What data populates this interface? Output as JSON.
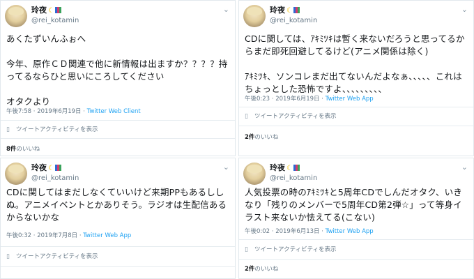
{
  "tweets": [
    {
      "display_name": "玲夜",
      "handle": "@rei_kotamin",
      "text": "あくたずいんふぉへ\n\n今年、原作ＣＤ関連で他に新情報は出ますか？？？？持ってるならひと思いにころしてください\n\nオタクより",
      "time": "午後7:58 · 2019年6月19日 · ",
      "source": "Twitter Web Client",
      "activity": "ツイートアクティビティを表示",
      "likes_count": "8件",
      "likes_label": "のいいね"
    },
    {
      "display_name": "玲夜",
      "handle": "@rei_kotamin",
      "text": "CDに関しては、ｱｷﾐﾂｷは暫く来ないだろうと思ってるからまだ即死回避してるけど(アニメ関係は除く)\n\nｱｷﾐﾂｷ、ソンコレまだ出てないんだよなぁ、、、、、これはちょっとした恐怖ですよ、、、、、、、、、",
      "time": "午後0:23 · 2019年6月19日 · ",
      "source": "Twitter Web App",
      "activity": "ツイートアクティビティを表示",
      "likes_count": "2件",
      "likes_label": "のいいね"
    },
    {
      "display_name": "玲夜",
      "handle": "@rei_kotamin",
      "text": "CDに関してはまだしなくていいけど来期PPもあるししぬ。アニメイベントとかありそう。ラジオは生配信あるからないかな",
      "time": "午後0:32 · 2019年7月8日 · ",
      "source": "Twitter Web App",
      "activity": "ツイートアクティビティを表示"
    },
    {
      "display_name": "玲夜",
      "handle": "@rei_kotamin",
      "text": "人気投票の時のｱｷﾐﾂｷと5周年CDでしんだオタク、いきなり「残りのメンバーで5周年CD第2弾☆」って等身イラスト来ないか怯えてる(こない)",
      "time": "午後0:02 · 2019年6月13日 · ",
      "source": "Twitter Web App",
      "activity": "ツイートアクティビティを表示",
      "likes_count": "2件",
      "likes_label": "のいいね"
    }
  ],
  "icons": {
    "avatar": "avatar-image",
    "chevron": "chevron-down-icon",
    "activity": "bar-chart-icon",
    "moon": "crescent-moon-emoji",
    "badge": "flag-emoji"
  },
  "colors": {
    "link": "#1da1f2",
    "meta": "#657786",
    "border": "#e1e8ed"
  }
}
